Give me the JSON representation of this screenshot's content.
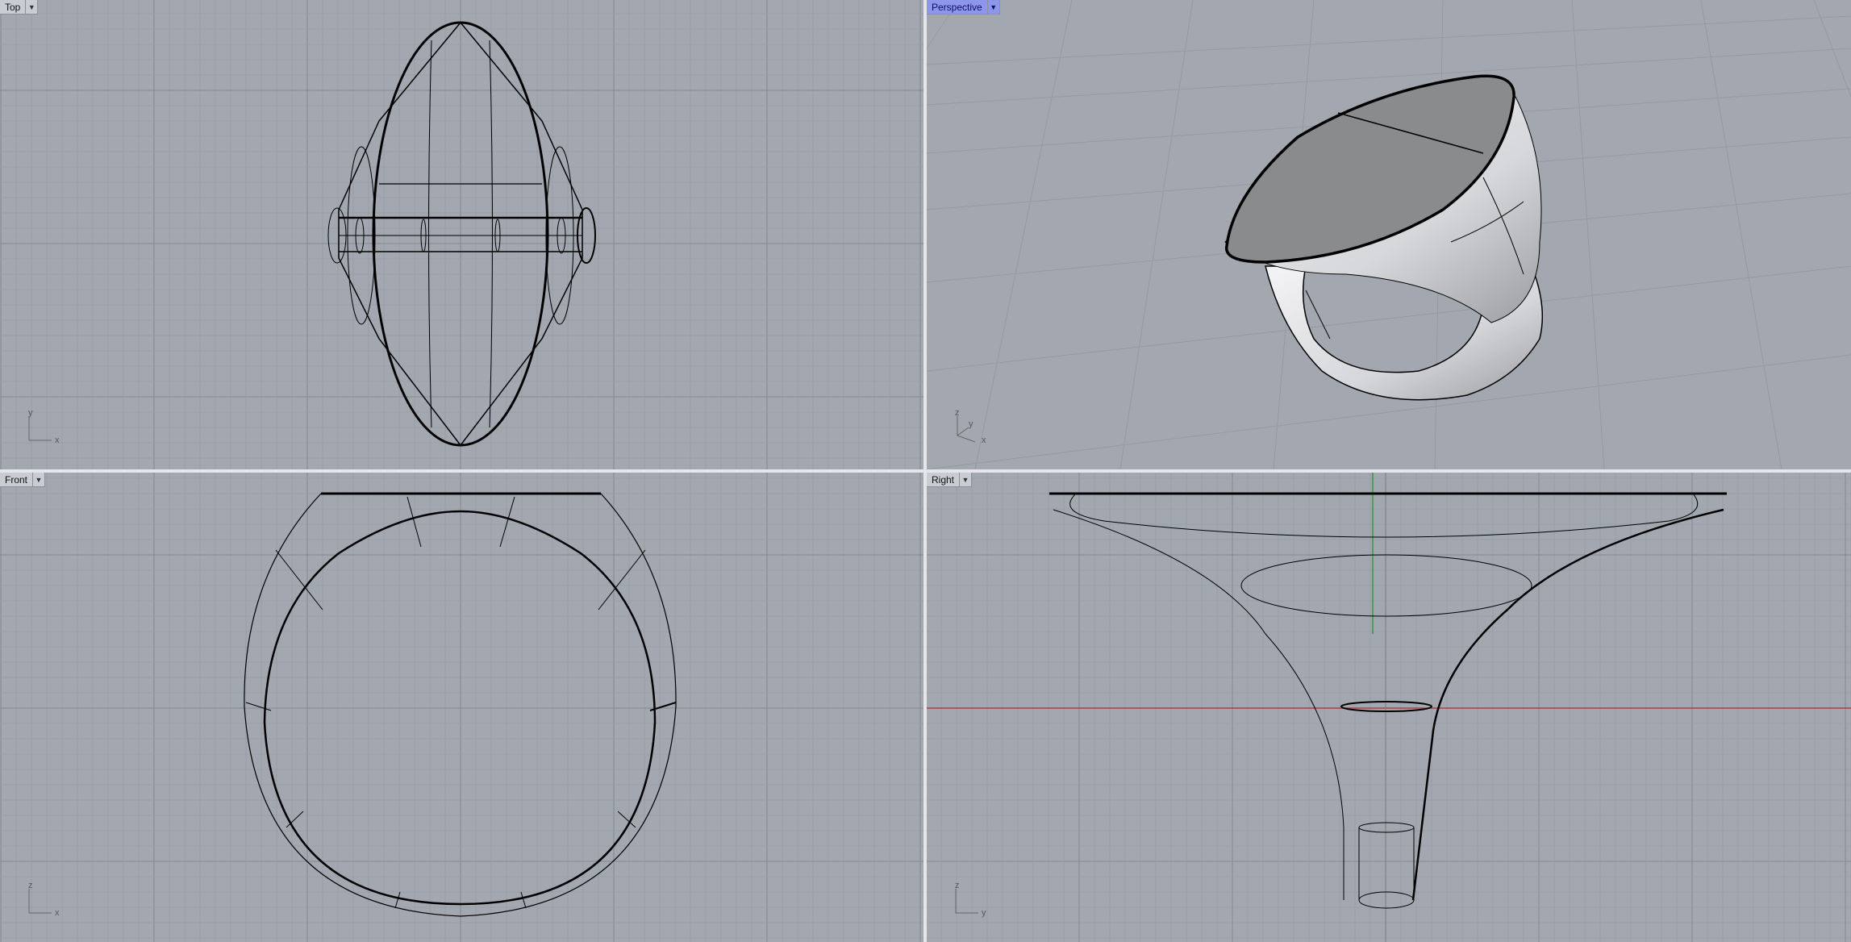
{
  "viewports": {
    "top": {
      "label": "Top",
      "axis_a": "y",
      "axis_b": "x"
    },
    "perspective": {
      "label": "Perspective",
      "axis_a": "z",
      "axis_b": "x",
      "axis_c": "y",
      "active": true
    },
    "front": {
      "label": "Front",
      "axis_a": "z",
      "axis_b": "x"
    },
    "right": {
      "label": "Right",
      "axis_a": "z",
      "axis_b": "y"
    }
  },
  "colors": {
    "viewport_bg": "#a3a8b0",
    "grid_minor": "#979ca4",
    "grid_major": "#8a8f97",
    "active_tab": "#8c96ea",
    "x_axis": "#a8323a",
    "y_axis": "#2a8a3a",
    "wire": "#000000",
    "shaded_top": "#8a8b8d",
    "shaded_metal": "#e8e8ea"
  },
  "icons": {
    "dropdown": "chevron-down-icon"
  }
}
